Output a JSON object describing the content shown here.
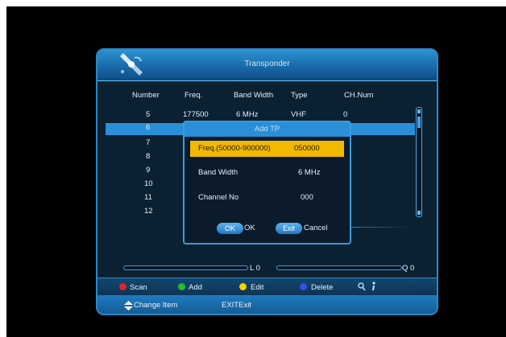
{
  "header": {
    "title": "Transponder"
  },
  "table": {
    "columns": [
      "Number",
      "Freq.",
      "Band Width",
      "Type",
      "CH.Num"
    ],
    "rows": [
      {
        "number": "5",
        "freq": "177500",
        "band": "6 MHz",
        "type": "VHF",
        "ch": "0"
      },
      {
        "number": "6"
      },
      {
        "number": "7"
      },
      {
        "number": "8"
      },
      {
        "number": "9"
      },
      {
        "number": "10"
      },
      {
        "number": "11"
      },
      {
        "number": "12"
      }
    ]
  },
  "dialog": {
    "title": "Add TP",
    "freq_label": "Freq.(50000-900000)",
    "freq_value": "050000",
    "bw_label": "Band Width",
    "bw_value": "6 MHz",
    "ch_label": "Channel No",
    "ch_value": "000",
    "ok_btn": "OK",
    "ok_label": "OK",
    "exit_btn": "Exit",
    "exit_label": "Cancel"
  },
  "signal": {
    "level_label": "L 0",
    "quality_label": "Q 0",
    "level": 0,
    "quality": 0
  },
  "footer": {
    "scan": "Scan",
    "add": "Add",
    "edit": "Edit",
    "delete": "Delete",
    "change_item": "Change Item",
    "exit_hint": "EXITExit",
    "colors": {
      "red": "#e8212c",
      "green": "#1fbf2a",
      "yellow": "#f2d400",
      "blue": "#3250e6"
    }
  },
  "icons": [
    "satellite-logo-icon",
    "search-icon",
    "info-icon",
    "up-down-arrow-icon"
  ]
}
